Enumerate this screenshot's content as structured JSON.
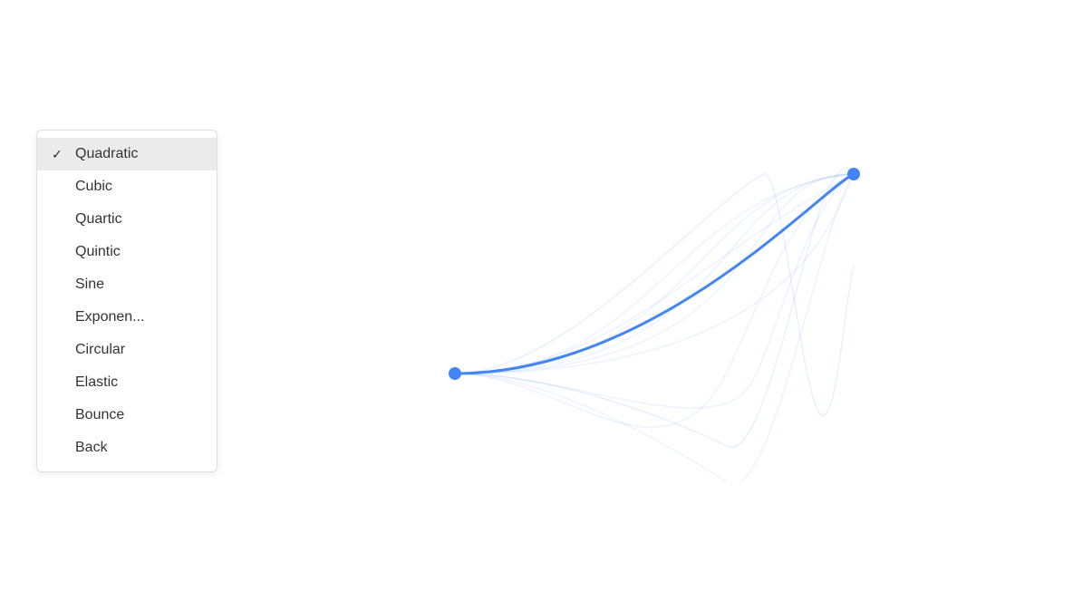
{
  "menu": {
    "items": [
      {
        "id": "quadratic",
        "label": "Quadratic",
        "selected": true
      },
      {
        "id": "cubic",
        "label": "Cubic",
        "selected": false
      },
      {
        "id": "quartic",
        "label": "Quartic",
        "selected": false
      },
      {
        "id": "quintic",
        "label": "Quintic",
        "selected": false
      },
      {
        "id": "sine",
        "label": "Sine",
        "selected": false
      },
      {
        "id": "exponential",
        "label": "Exponen...",
        "selected": false
      },
      {
        "id": "circular",
        "label": "Circular",
        "selected": false
      },
      {
        "id": "elastic",
        "label": "Elastic",
        "selected": false
      },
      {
        "id": "bounce",
        "label": "Bounce",
        "selected": false
      },
      {
        "id": "back",
        "label": "Back",
        "selected": false
      }
    ]
  },
  "chart": {
    "accent_color": "#4285f4",
    "light_color": "rgba(66,133,244,0.15)"
  }
}
